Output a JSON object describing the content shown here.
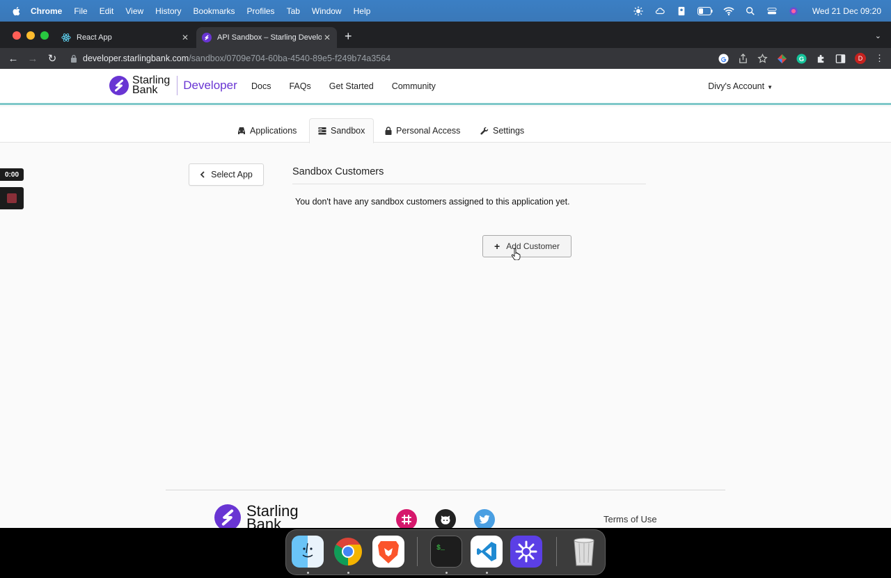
{
  "menubar": {
    "items": [
      "Chrome",
      "File",
      "Edit",
      "View",
      "History",
      "Bookmarks",
      "Profiles",
      "Tab",
      "Window",
      "Help"
    ],
    "clock": "Wed 21 Dec  09:20"
  },
  "browser": {
    "tabs": [
      {
        "title": "React App",
        "active": false
      },
      {
        "title": "API Sandbox – Starling Developer",
        "active": true
      }
    ],
    "url_host": "developer.starlingbank.com",
    "url_path": "/sandbox/0709e704-60ba-4540-89e5-f249b74a3564",
    "profile_initial": "D"
  },
  "header": {
    "brand_line1": "Starling",
    "brand_line2": "Bank",
    "brand_product": "Developer",
    "nav": [
      "Docs",
      "FAQs",
      "Get Started",
      "Community"
    ],
    "account": "Divy's Account"
  },
  "subnav": {
    "tabs": [
      {
        "label": "Applications",
        "icon": "car-icon"
      },
      {
        "label": "Sandbox",
        "icon": "server-icon",
        "active": true
      },
      {
        "label": "Personal Access",
        "icon": "lock-icon"
      },
      {
        "label": "Settings",
        "icon": "wrench-icon"
      }
    ]
  },
  "recorder": {
    "time": "0:00"
  },
  "content": {
    "back_label": "Select App",
    "title": "Sandbox Customers",
    "empty_message": "You don't have any sandbox customers assigned to this application yet.",
    "add_label": "Add Customer"
  },
  "footer": {
    "brand_line1": "Starling",
    "brand_line2": "Bank",
    "terms": "Terms of Use",
    "social": [
      "slack-icon",
      "github-icon",
      "twitter-icon"
    ]
  },
  "dock": {
    "apps": [
      "finder-icon",
      "chrome-icon",
      "brave-icon",
      "terminal-icon",
      "vscode-icon",
      "perplexity-icon",
      "trash-icon"
    ]
  },
  "colors": {
    "brand_purple": "#6935d3",
    "menubar_blue": "#3a78b8",
    "header_accent": "#7ec8c9"
  }
}
